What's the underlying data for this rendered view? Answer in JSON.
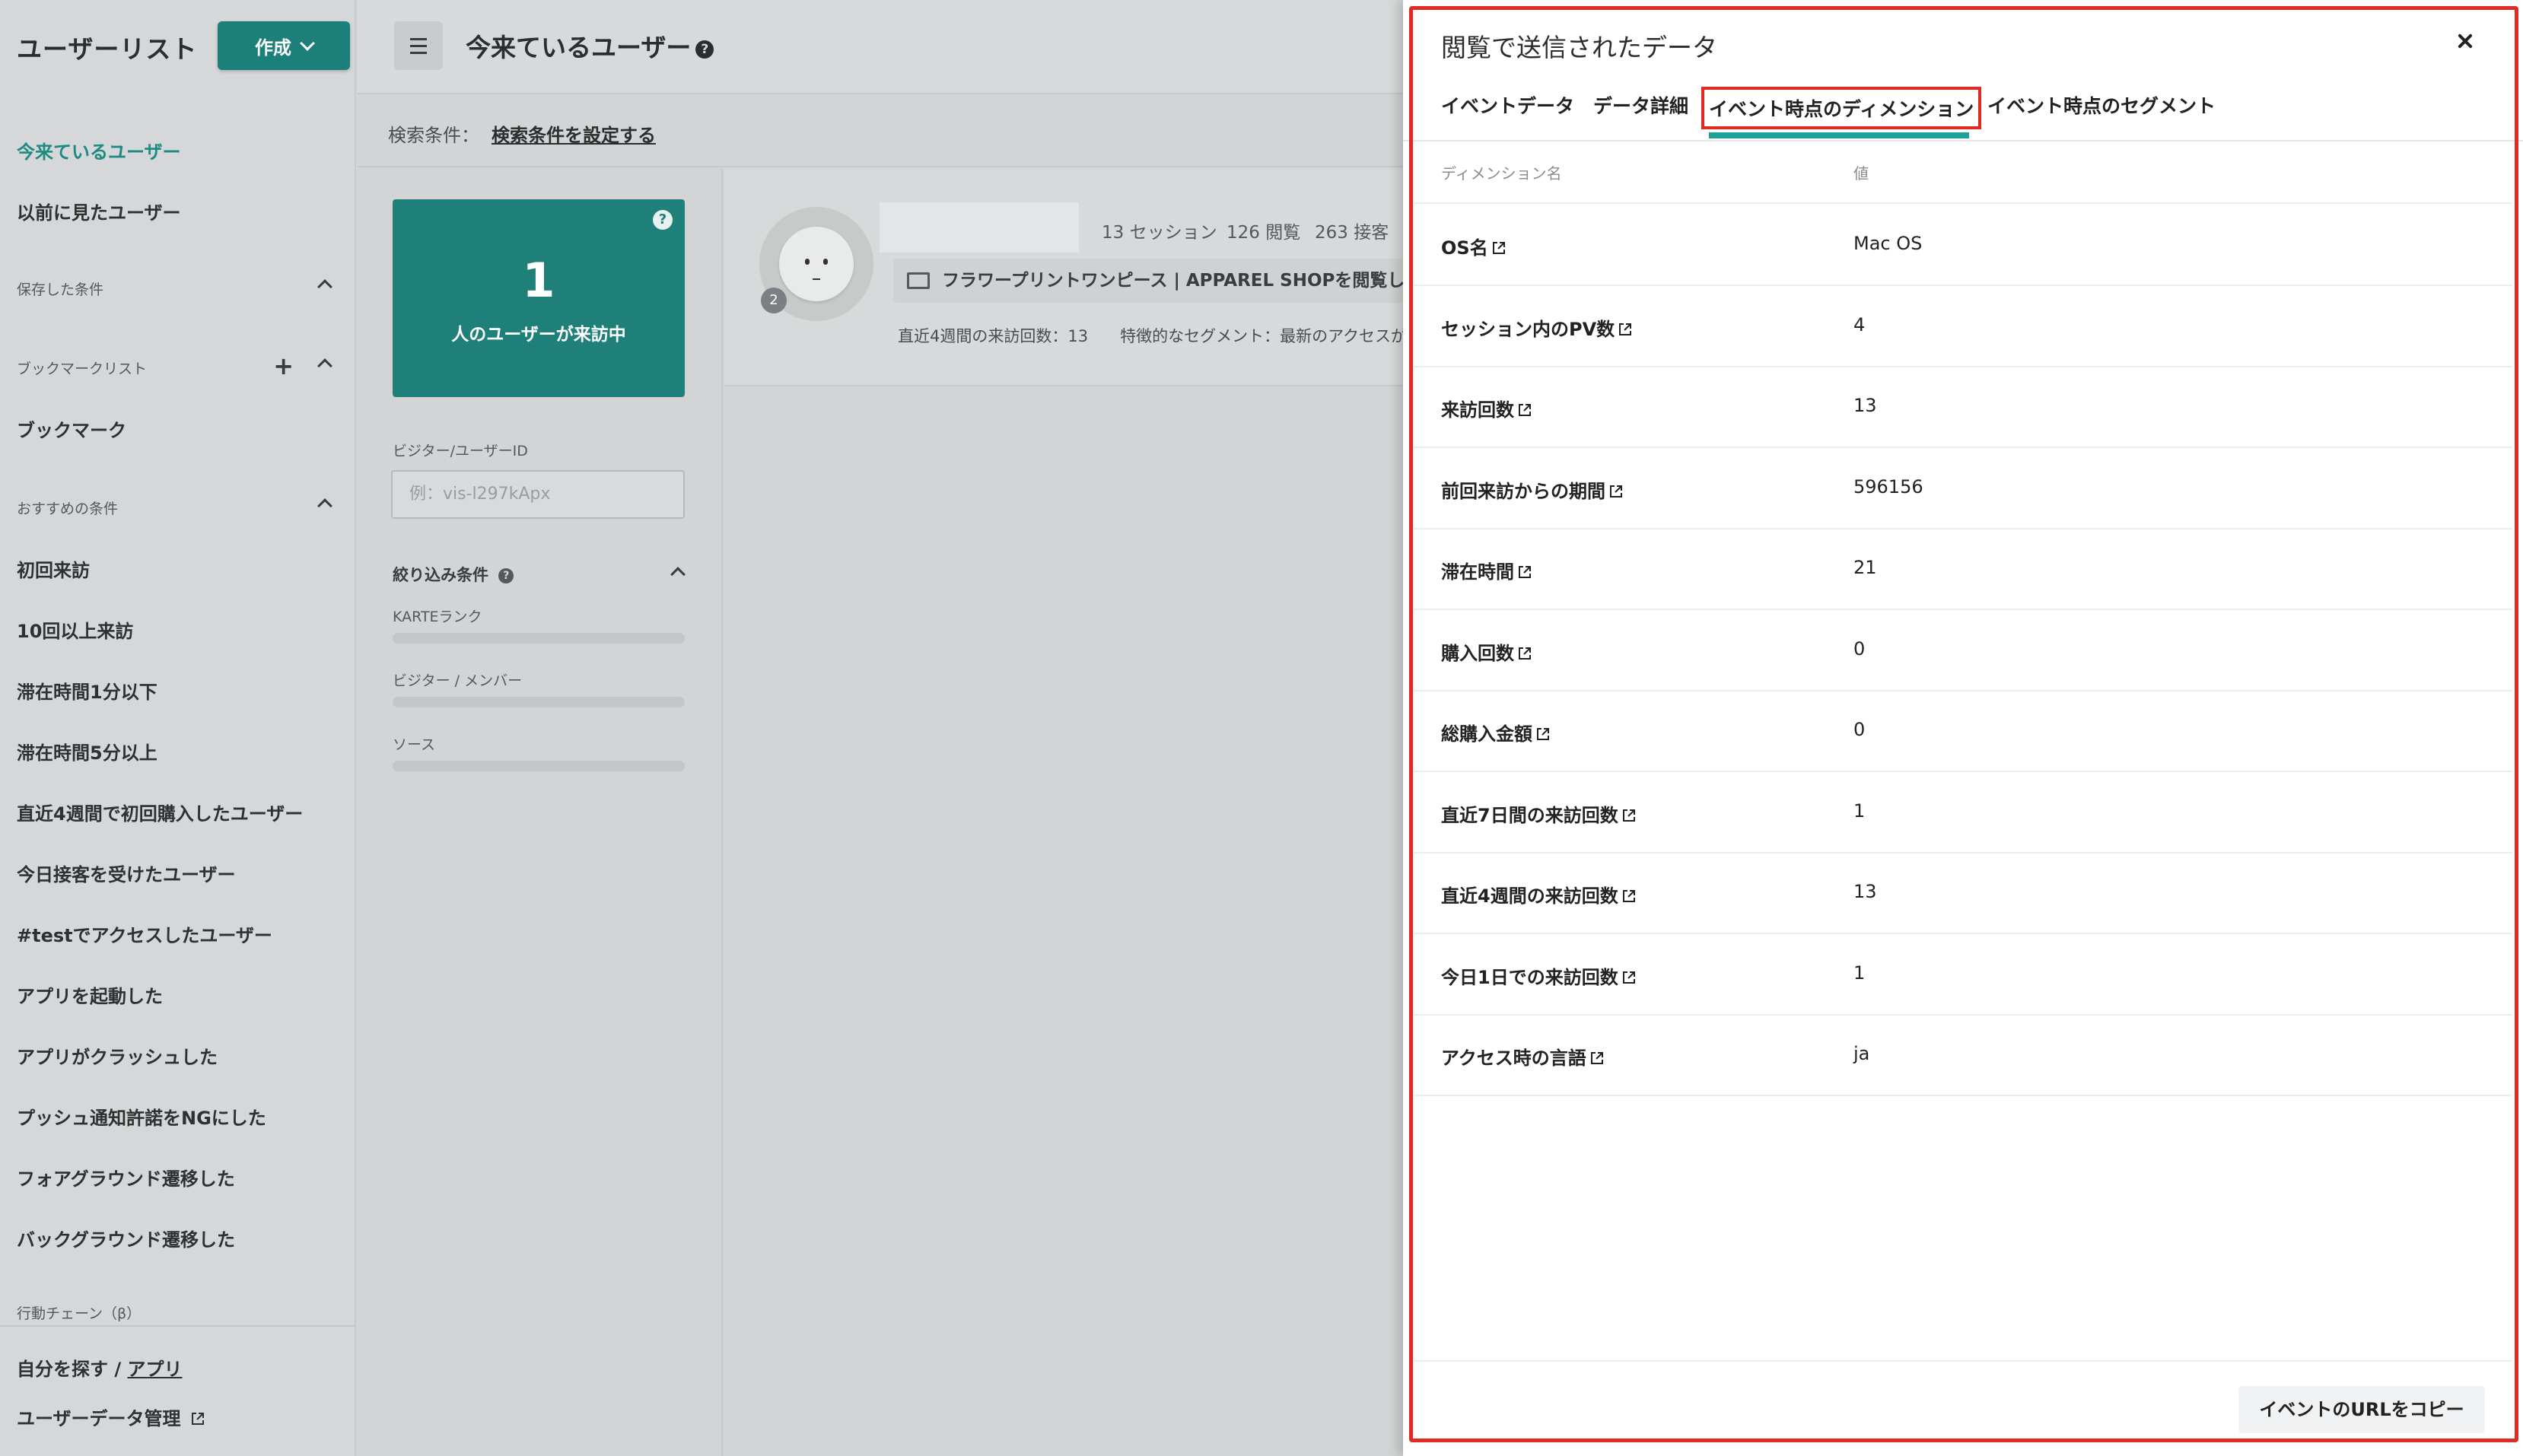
{
  "sidebar": {
    "title": "ユーザーリスト",
    "create_label": "作成",
    "items_top": [
      "今来ているユーザー",
      "以前に見たユーザー"
    ],
    "saved_label": "保存した条件",
    "bookmark_list_label": "ブックマークリスト",
    "bookmark_item": "ブックマーク",
    "recommended_label": "おすすめの条件",
    "recommended": [
      "初回来訪",
      "10回以上来訪",
      "滞在時間1分以下",
      "滞在時間5分以上",
      "直近4週間で初回購入したユーザー",
      "今日接客を受けたユーザー",
      "#testでアクセスしたユーザー",
      "アプリを起動した",
      "アプリがクラッシュした",
      "プッシュ通知許諾をNGにした",
      "フォアグラウンド遷移した",
      "バックグラウンド遷移した"
    ],
    "chain_label": "行動チェーン（β）",
    "find_self": "自分を探す / ",
    "find_self_link": "アプリ",
    "user_data": "ユーザーデータ管理"
  },
  "header": {
    "title": "今来ているユーザー",
    "help": "?",
    "search_label": "検索条件：",
    "search_link": "検索条件を設定する"
  },
  "filters": {
    "count": "1",
    "count_label": "人のユーザーが来訪中",
    "count_help": "?",
    "visitor_id_label": "ビジター/ユーザーID",
    "visitor_id_placeholder": "例：vis-l297kApx",
    "narrow_label": "絞り込み条件",
    "narrow_help": "?",
    "rank_label": "KARTEランク",
    "member_label": "ビジター / メンバー",
    "source_label": "ソース"
  },
  "user_card": {
    "badge": "2",
    "sessions": "13 セッション",
    "views": "126 閲覧",
    "contacts": "263 接客",
    "page": "フラワープリントワンピース | APPAREL SHOPを閲覧し",
    "meta": "直近4週間の来訪回数：13　　特徴的なセグメント：最新のアクセスが"
  },
  "panel": {
    "title": "閲覧で送信されたデータ",
    "tabs": [
      "イベントデータ",
      "データ詳細",
      "イベント時点のディメンション",
      "イベント時点のセグメント"
    ],
    "active_tab_index": 2,
    "col_name": "ディメンション名",
    "col_value": "値",
    "rows": [
      {
        "name": "OS名",
        "value": "Mac OS"
      },
      {
        "name": "セッション内のPV数",
        "value": "4"
      },
      {
        "name": "来訪回数",
        "value": "13"
      },
      {
        "name": "前回来訪からの期間",
        "value": "596156"
      },
      {
        "name": "滞在時間",
        "value": "21"
      },
      {
        "name": "購入回数",
        "value": "0"
      },
      {
        "name": "総購入金額",
        "value": "0"
      },
      {
        "name": "直近7日間の来訪回数",
        "value": "1"
      },
      {
        "name": "直近4週間の来訪回数",
        "value": "13"
      },
      {
        "name": "今日1日での来訪回数",
        "value": "1"
      },
      {
        "name": "アクセス時の言語",
        "value": "ja"
      }
    ],
    "copy_button": "イベントのURLをコピー"
  },
  "colors": {
    "accent": "#1e8079",
    "highlight": "#e02b24",
    "active_text": "#1d8a84"
  }
}
